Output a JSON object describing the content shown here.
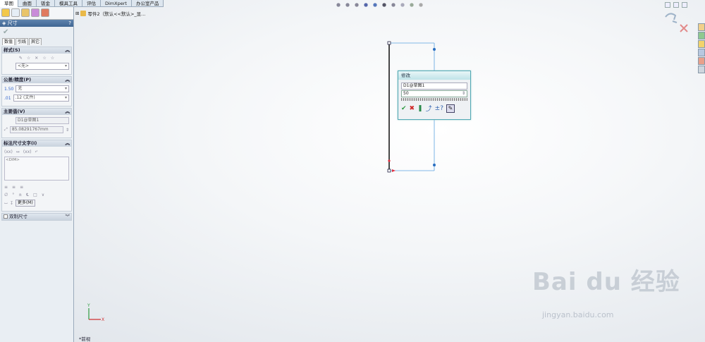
{
  "tabs": [
    "草图",
    "曲面",
    "钣金",
    "模具工具",
    "评估",
    "DimXpert",
    "办公室产品"
  ],
  "active_tab": 0,
  "hud_icons": [
    "zoom-fit-icon",
    "zoom-area-icon",
    "previous-view-icon",
    "section-view-icon",
    "view-orientation-icon",
    "display-style-icon",
    "hide-show-icon",
    "edit-appearance-icon",
    "apply-scene-icon",
    "view-settings-icon"
  ],
  "tree": {
    "label": "零件2（默认<<默认>_显..."
  },
  "panel": {
    "title": "尺寸",
    "help": "?",
    "subtabs": [
      "数值",
      "引线",
      "其它"
    ],
    "style_group": {
      "title": "样式(S)",
      "select": "<无>"
    },
    "tolerance_group": {
      "title": "公差/精度(P)",
      "tolerance": "无",
      "precision": ".12 (文件)"
    },
    "primary_group": {
      "title": "主要值(V)",
      "name": "D1@草图1",
      "value": "85.08291767mm"
    },
    "dimtext_group": {
      "title": "标注尺寸文字(I)",
      "text": "<DIM>",
      "more_button": "更多(M)"
    },
    "dual_group": {
      "title": "双制尺寸"
    }
  },
  "modify_dialog": {
    "title": "修改",
    "name": "D1@草图1",
    "value": "50"
  },
  "view_label": "*前视",
  "watermark": {
    "text": "Bai  du 经验",
    "url": "jingyan.baidu.com"
  },
  "colors": {
    "sketch_line": "#1a1a1a",
    "construction": "#5ba2e0",
    "dialog_border": "#52a8b4",
    "title_bar": "#3f6693"
  }
}
